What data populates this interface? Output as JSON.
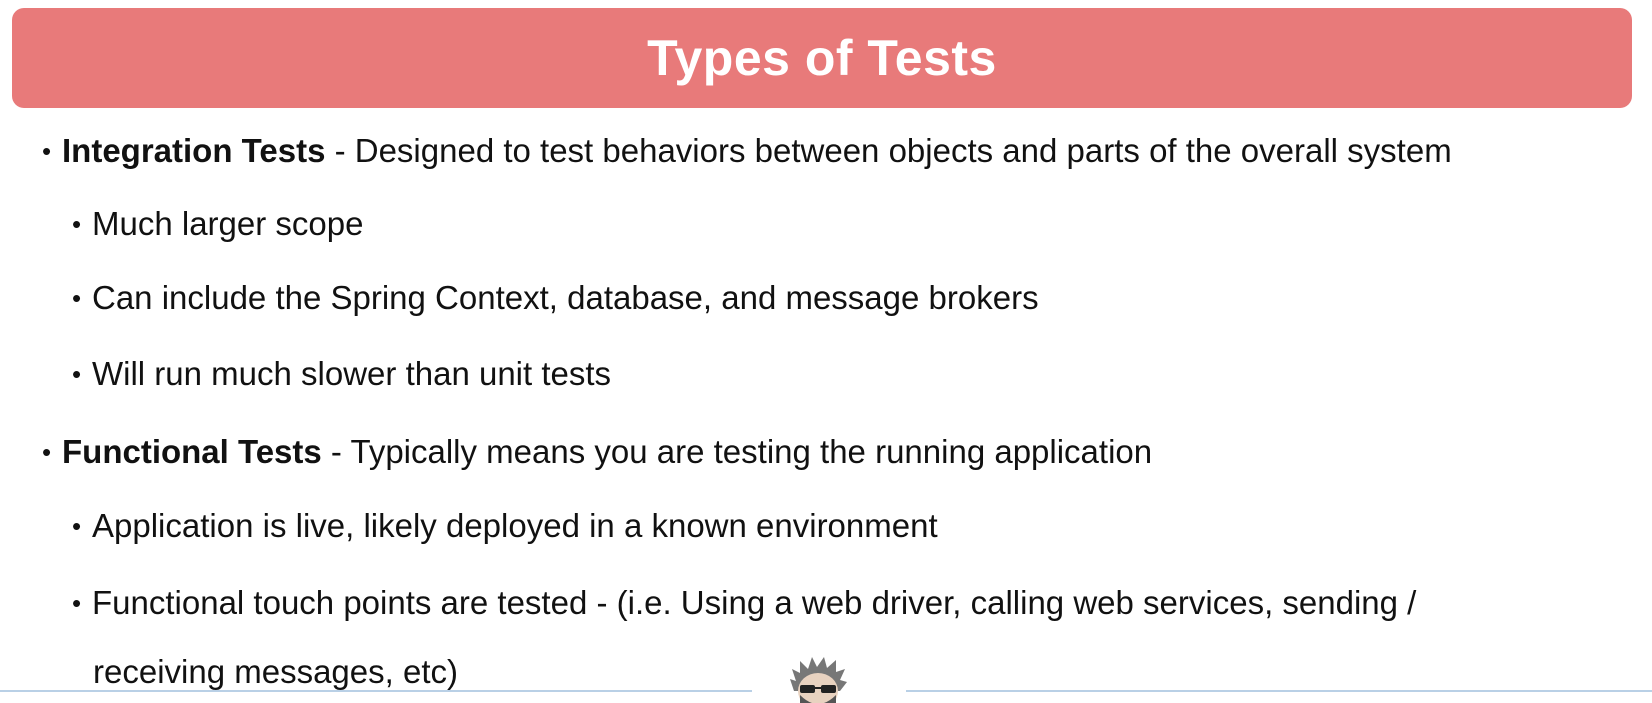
{
  "slide": {
    "title": "Types of Tests",
    "bullets": [
      {
        "term": "Integration Tests",
        "text": " - Designed to test behaviors between objects and parts of the overall system",
        "sub": [
          "Much larger scope",
          "Can include the Spring Context, database, and message brokers",
          "Will run much slower than unit tests"
        ]
      },
      {
        "term": "Functional Tests",
        "text": " - Typically means you are testing the running application",
        "sub": [
          "Application is live, likely deployed in a known environment",
          "Functional touch points are tested - (i.e. Using a web driver, calling web services, sending /"
        ],
        "continuation": "receiving messages, etc)"
      }
    ],
    "bullet_glyph": "•"
  },
  "colors": {
    "title_bar": "#e87a7a",
    "title_text": "#ffffff",
    "body_text": "#111111",
    "footer_line": "#b9d0e6"
  },
  "footer": {
    "logo_icon": "bearded-head-logo"
  }
}
